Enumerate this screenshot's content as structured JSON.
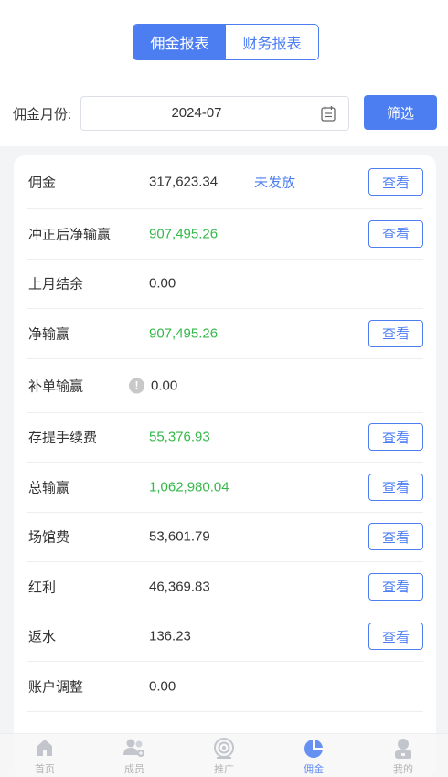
{
  "tabs": [
    {
      "label": "佣金报表",
      "active": true
    },
    {
      "label": "财务报表",
      "active": false
    }
  ],
  "filter": {
    "label": "佣金月份:",
    "date": "2024-07",
    "button": "筛选"
  },
  "view_label": "查看",
  "rows": [
    {
      "label": "佣金",
      "value": "317,623.34",
      "status": "未发放"
    },
    {
      "label": "冲正后净输赢",
      "value": "907,495.26"
    },
    {
      "label": "上月结余",
      "value": "0.00"
    },
    {
      "label": "净输赢",
      "value": "907,495.26"
    },
    {
      "label": "补单输赢",
      "value": "0.00",
      "info_icon": "!"
    },
    {
      "label": "存提手续费",
      "value": "55,376.93"
    },
    {
      "label": "总输赢",
      "value": "1,062,980.04"
    },
    {
      "label": "场馆费",
      "value": "53,601.79"
    },
    {
      "label": "红利",
      "value": "46,369.83"
    },
    {
      "label": "返水",
      "value": "136.23"
    },
    {
      "label": "账户调整",
      "value": "0.00"
    }
  ],
  "nav": [
    {
      "label": "首页",
      "icon": "home-icon"
    },
    {
      "label": "成员",
      "icon": "members-icon"
    },
    {
      "label": "推广",
      "icon": "promote-icon"
    },
    {
      "label": "佣金",
      "icon": "commission-pie-icon",
      "active": true
    },
    {
      "label": "我的",
      "icon": "profile-icon"
    }
  ],
  "colors": {
    "accent": "#4c7ef2",
    "positive": "#35b84a"
  }
}
